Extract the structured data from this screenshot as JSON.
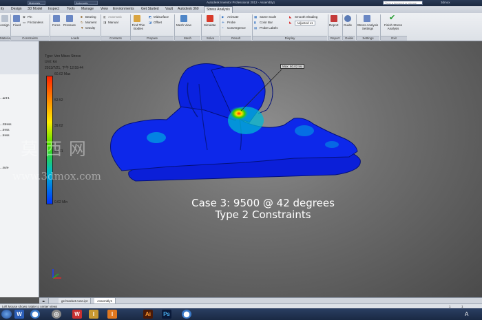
{
  "titlebar": {
    "project_combo": "Materials",
    "view_combo": "Automatic",
    "title": "Autodesk Inventor Professional 2012 - Assembly1",
    "search_placeholder": "Type a keyword or phrase",
    "user": "3dmox"
  },
  "tabs": [
    {
      "label": "ity"
    },
    {
      "label": "Design"
    },
    {
      "label": "3D Model"
    },
    {
      "label": "Inspect"
    },
    {
      "label": "Tools"
    },
    {
      "label": "Manage"
    },
    {
      "label": "View"
    },
    {
      "label": "Environments"
    },
    {
      "label": "Get Started"
    },
    {
      "label": "Vault"
    },
    {
      "label": "Autodesk 360"
    },
    {
      "label": "Stress Analysis"
    }
  ],
  "ribbon": {
    "material": {
      "assign": "Assign",
      "label": "Material"
    },
    "constraints": {
      "fixed": "Fixed",
      "pin": "Pin",
      "frictionless": "Frictionless",
      "label": "Constraints"
    },
    "loads": {
      "force": "Force",
      "pressure": "Pressure",
      "bearing": "Bearing",
      "moment": "Moment",
      "gravity": "Gravity",
      "label": "Loads"
    },
    "contacts": {
      "automatic": "Automatic",
      "manual": "Manual",
      "label": "Contacts"
    },
    "prepare": {
      "find_thin": "Find Thin Bodies",
      "midsurface": "Midsurface",
      "offset": "Offset",
      "label": "Prepare"
    },
    "mesh": {
      "mesh_view": "Mesh View",
      "label": "Mesh"
    },
    "solve": {
      "simulate": "Simulate",
      "label": "Solve"
    },
    "result": {
      "animate": "Animate",
      "probe": "Probe",
      "convergence": "Convergence",
      "label": "Result"
    },
    "display": {
      "same_scale": "Same Scale",
      "color_bar": "Color Bar",
      "probe_labels": "Probe Labels",
      "smooth_shading": "Smooth Shading",
      "adjusted": "Adjusted x1",
      "label": "Display"
    },
    "report": {
      "report": "Report",
      "label": "Report"
    },
    "guide": {
      "guide": "Guide",
      "label": "Guide"
    },
    "settings": {
      "settings": "Stress Analysis Settings",
      "label": "Settings"
    },
    "exit": {
      "finish": "Finish Stress Analysis",
      "label": "Exit"
    }
  },
  "browser": {
    "items": [
      "...ant:1",
      "...Stress",
      "...tress",
      "...tress",
      "...sure"
    ]
  },
  "viewport": {
    "result_type": "Type: Von Mises Stress",
    "unit": "Unit: ksi",
    "date": "2013/7/21, 下午 12:59:44",
    "max_tag": "Max: 60.02 ksi",
    "colorbar": {
      "max_label": "60.02 Max",
      "ticks": [
        "52.52",
        "39.02",
        "26.01"
      ],
      "min_label": "0.02 Min"
    },
    "case_line1": "Case 3: 9500 @ 42 degrees",
    "case_line2": "Type 2 Constraints"
  },
  "watermark": {
    "chinese": "莫 西 网",
    "url": "www.3dmox.com"
  },
  "doctabs": [
    "ge bracket conn.ipt",
    "Assembly1"
  ],
  "status": {
    "text": "Left Mouse shows rotate to center views",
    "n1": "1",
    "n2": "1"
  },
  "taskbar": {
    "apps": [
      "W",
      "⬤",
      "◎",
      "W",
      "I",
      "Ai",
      "Ps",
      "⬤"
    ],
    "tray": "A"
  },
  "colors": {
    "result_blue": "#0a26e6",
    "stress_hot": "#ff3300",
    "ribbon_bg": "#e6e9ee",
    "taskbar": "#22355a"
  }
}
